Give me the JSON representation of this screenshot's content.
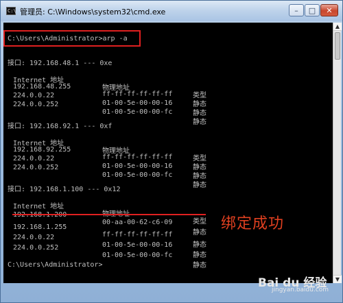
{
  "window": {
    "title": "管理员: C:\\Windows\\system32\\cmd.exe",
    "icon_text": "C:\\",
    "controls": {
      "minimize": "–",
      "maximize": "□",
      "close": "✕"
    }
  },
  "console": {
    "prompt_command": "C:\\Users\\Administrator>arp -a",
    "interfaces": [
      {
        "header": "接口: 192.168.48.1 --- 0xe",
        "col_internet": "Internet 地址",
        "col_physical": "物理地址",
        "col_type": "类型",
        "rows": [
          {
            "ip": "192.168.48.255",
            "mac": "ff-ff-ff-ff-ff-ff",
            "type": "静态"
          },
          {
            "ip": "224.0.0.22",
            "mac": "01-00-5e-00-00-16",
            "type": "静态"
          },
          {
            "ip": "224.0.0.252",
            "mac": "01-00-5e-00-00-fc",
            "type": "静态"
          }
        ]
      },
      {
        "header": "接口: 192.168.92.1 --- 0xf",
        "col_internet": "Internet 地址",
        "col_physical": "物理地址",
        "col_type": "类型",
        "rows": [
          {
            "ip": "192.168.92.255",
            "mac": "ff-ff-ff-ff-ff-ff",
            "type": "静态"
          },
          {
            "ip": "224.0.0.22",
            "mac": "01-00-5e-00-00-16",
            "type": "静态"
          },
          {
            "ip": "224.0.0.252",
            "mac": "01-00-5e-00-00-fc",
            "type": "静态"
          }
        ]
      },
      {
        "header": "接口: 192.168.1.100 --- 0x12",
        "col_internet": "Internet 地址",
        "col_physical": "物理地址",
        "col_type": "类型",
        "rows": [
          {
            "ip": "192.168.1.200",
            "mac": "00-aa-00-62-c6-09",
            "type": "静态"
          },
          {
            "ip": "192.168.1.255",
            "mac": "ff-ff-ff-ff-ff-ff",
            "type": "静态"
          },
          {
            "ip": "224.0.0.22",
            "mac": "01-00-5e-00-00-16",
            "type": "静态"
          },
          {
            "ip": "224.0.0.252",
            "mac": "01-00-5e-00-00-fc",
            "type": "静态"
          }
        ]
      }
    ],
    "final_prompt": "C:\\Users\\Administrator>"
  },
  "annotation": {
    "text": "绑定成功",
    "color": "#e04020"
  },
  "watermark": {
    "main": "Bai du 经验",
    "sub": "jingyan.baidu.com"
  }
}
